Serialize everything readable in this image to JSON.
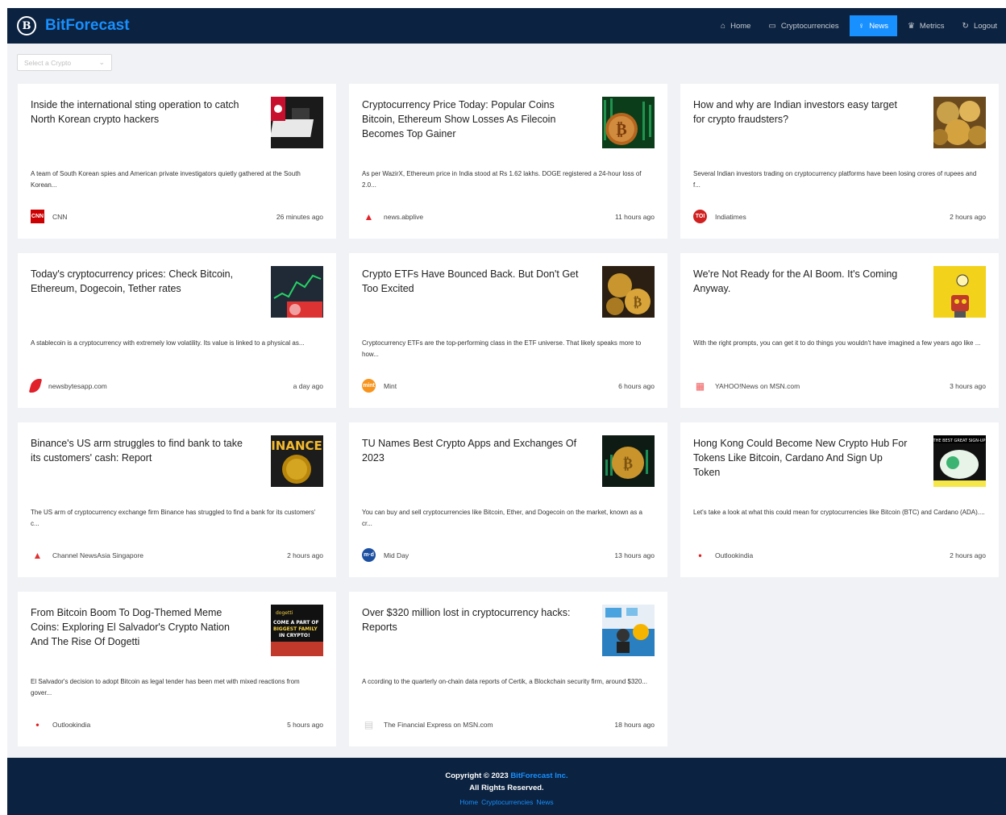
{
  "brand": {
    "logo_glyph": "B",
    "name": "BitForecast"
  },
  "nav": [
    {
      "icon": "home-icon",
      "glyph": "⌂",
      "label": "Home",
      "active": false
    },
    {
      "icon": "cryptocurrencies-icon",
      "glyph": "▭",
      "label": "Cryptocurrencies",
      "active": false
    },
    {
      "icon": "bulb-icon",
      "glyph": "♀",
      "label": "News",
      "active": true
    },
    {
      "icon": "crown-icon",
      "glyph": "♛",
      "label": "Metrics",
      "active": false
    },
    {
      "icon": "logout-icon",
      "glyph": "↻",
      "label": "Logout",
      "active": false
    }
  ],
  "select": {
    "placeholder": "Select a Crypto"
  },
  "news": [
    {
      "title": "Inside the international sting operation to catch North Korean crypto hackers",
      "description": "A team of South Korean spies and American private investigators quietly gathered at the South Korean...",
      "source": "CNN",
      "source_icon": "cnn-logo-icon",
      "source_icon_text": "CNN",
      "source_icon_color": "#cc0000",
      "time": "26 minutes ago",
      "thumb": "laptop-hacker-thumbnail"
    },
    {
      "title": "Cryptocurrency Price Today: Popular Coins Bitcoin, Ethereum Show Losses As Filecoin Becomes Top Gainer",
      "description": "As per WazirX, Ethereum price in India stood at Rs 1.62 lakhs. DOGE registered a 24-hour loss of 2.0...",
      "source": "news.abplive",
      "source_icon": "abplive-logo-icon",
      "source_icon_text": "▲",
      "source_icon_color": "#e2232a",
      "time": "11 hours ago",
      "thumb": "bitcoin-coin-thumbnail"
    },
    {
      "title": "How and why are Indian investors easy target for crypto fraudsters?",
      "description": "Several Indian investors trading on cryptocurrency platforms have been losing crores of rupees and f...",
      "source": "Indiatimes",
      "source_icon": "indiatimes-logo-icon",
      "source_icon_text": "TOI",
      "source_icon_color": "#d02020",
      "time": "2 hours ago",
      "thumb": "coins-pile-thumbnail"
    },
    {
      "title": "Today's cryptocurrency prices: Check Bitcoin, Ethereum, Dogecoin, Tether rates",
      "description": "A stablecoin is a cryptocurrency with extremely low volatility. Its value is linked to a physical as...",
      "source": "newsbytesapp.com",
      "source_icon": "newsbytes-logo-icon",
      "source_icon_text": "",
      "source_icon_color": "#e0202a",
      "time": "a day ago",
      "thumb": "trading-chart-thumbnail"
    },
    {
      "title": "Crypto ETFs Have Bounced Back. But Don't Get Too Excited",
      "description": "Cryptocurrency ETFs are the top-performing class in the ETF universe. That likely speaks more to how...",
      "source": "Mint",
      "source_icon": "mint-logo-icon",
      "source_icon_text": "mint",
      "source_icon_color": "#f7941d",
      "time": "6 hours ago",
      "thumb": "gold-bitcoins-thumbnail"
    },
    {
      "title": "We're Not Ready for the AI Boom. It's Coming Anyway.",
      "description": "With the right prompts, you can get it to do things you wouldn't have imagined a few years ago like ...",
      "source": "YAHOO!News on MSN.com",
      "source_icon": "msn-logo-icon",
      "source_icon_text": "▦",
      "source_icon_color": "#f05a5a",
      "time": "3 hours ago",
      "thumb": "robot-lightbulb-thumbnail"
    },
    {
      "title": "Binance's US arm struggles to find bank to take its customers' cash: Report",
      "description": "The US arm of cryptocurrency exchange firm Binance has struggled to find a bank for its customers' c...",
      "source": "Channel NewsAsia Singapore",
      "source_icon": "cna-logo-icon",
      "source_icon_text": "▲",
      "source_icon_color": "#e03030",
      "time": "2 hours ago",
      "thumb": "binance-coin-thumbnail"
    },
    {
      "title": "TU Names Best Crypto Apps and Exchanges Of 2023",
      "description": "You can buy and sell cryptocurrencies like Bitcoin, Ether, and Dogecoin on the market, known as a cr...",
      "source": "Mid Day",
      "source_icon": "midday-logo-icon",
      "source_icon_text": "m·d",
      "source_icon_color": "#1c4fa0",
      "time": "13 hours ago",
      "thumb": "bitcoin-chart-thumbnail"
    },
    {
      "title": "Hong Kong Could Become New Crypto Hub For Tokens Like Bitcoin, Cardano And Sign Up Token",
      "description": "Let's take a look at what this could mean for cryptocurrencies like Bitcoin (BTC) and Cardano (ADA)....",
      "source": "Outlookindia",
      "source_icon": "outlook-logo-icon",
      "source_icon_text": "•",
      "source_icon_color": "#e02020",
      "time": "2 hours ago",
      "thumb": "crypto-banner-thumbnail"
    },
    {
      "title": "From Bitcoin Boom To Dog-Themed Meme Coins: Exploring El Salvador's Crypto Nation And The Rise Of Dogetti",
      "description": "El Salvador's decision to adopt Bitcoin as legal tender has been met with mixed reactions from gover...",
      "source": "Outlookindia",
      "source_icon": "outlook-logo-icon",
      "source_icon_text": "•",
      "source_icon_color": "#e02020",
      "time": "5 hours ago",
      "thumb": "dogetti-banner-thumbnail"
    },
    {
      "title": "Over $320 million lost in cryptocurrency hacks: Reports",
      "description": "A ccording to the quarterly on-chain data reports of Certik, a Blockchain security firm, around $320...",
      "source": "The Financial Express on MSN.com",
      "source_icon": "msn-logo-icon",
      "source_icon_text": "▤",
      "source_icon_color": "#cfcfcf",
      "time": "18 hours ago",
      "thumb": "crypto-thief-thumbnail"
    }
  ],
  "footer": {
    "copyright": "Copyright © 2023",
    "company": "BitForecast Inc.",
    "rights": "All Rights Reserved.",
    "links": [
      "Home",
      "Cryptocurrencies",
      "News"
    ]
  }
}
